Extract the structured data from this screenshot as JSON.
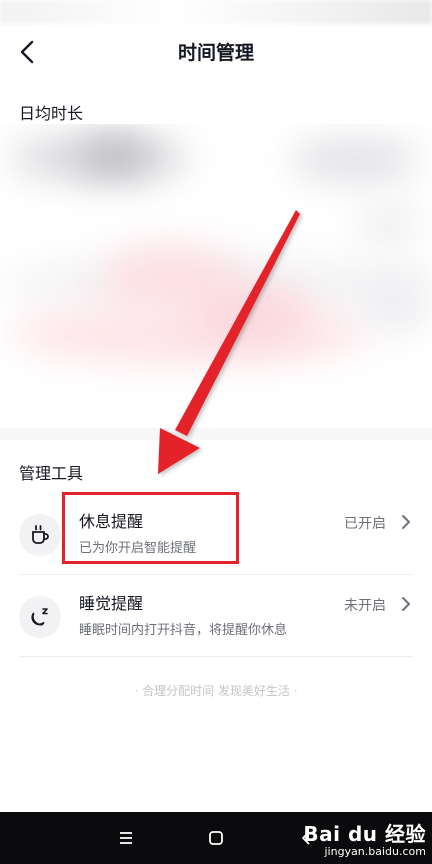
{
  "header": {
    "title": "时间管理",
    "back_icon": "chevron-left-icon"
  },
  "daily": {
    "section_title": "日均时长"
  },
  "tools": {
    "section_title": "管理工具",
    "items": [
      {
        "title": "休息提醒",
        "subtitle": "已为你开启智能提醒",
        "status": "已开启",
        "icon": "cup-icon"
      },
      {
        "title": "睡觉提醒",
        "subtitle": "睡眠时间内打开抖音，将提醒你休息",
        "status": "未开启",
        "icon": "moon-icon"
      }
    ]
  },
  "footer": {
    "slogan": "· 合理分配时间 发现美好生活 ·"
  },
  "navbar": {
    "icons": [
      "menu-icon",
      "square-icon",
      "back-triangle-icon"
    ]
  },
  "watermark": {
    "brand": "Bai du 经验",
    "url": "jingyan.baidu.com"
  },
  "colors": {
    "accent_red": "#e3222b",
    "text_primary": "#161823",
    "text_secondary": "#6e7079",
    "nav_bg": "#0b0b0d"
  }
}
